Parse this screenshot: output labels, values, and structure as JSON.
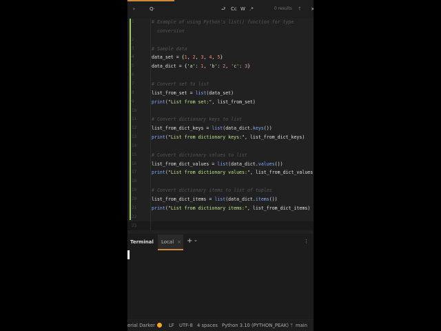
{
  "toolbar": {
    "expand": "›",
    "search_icon": "Q·",
    "replace_icon": "⮐",
    "match_case": "Cc",
    "words": "W",
    "regex": ".*",
    "results": "0 results",
    "up": "↑",
    "close": "×"
  },
  "editor": {
    "line_numbers": [
      "1",
      "",
      "2",
      "3",
      "4",
      "5",
      "6",
      "7",
      "8",
      "9",
      "10",
      "11",
      "12",
      "13",
      "14",
      "15",
      "16",
      "17",
      "18",
      "19",
      "20",
      "21",
      "22",
      "23"
    ],
    "lines": [
      [
        [
          "# Example of using Python's list() function for type",
          "cm"
        ]
      ],
      [
        [
          "  conversion",
          "cm"
        ]
      ],
      [],
      [
        [
          "# Sample data",
          "cm"
        ]
      ],
      [
        [
          "data_set = {",
          "pl"
        ],
        [
          "1",
          "nm"
        ],
        [
          ", ",
          "pl"
        ],
        [
          "2",
          "nm"
        ],
        [
          ", ",
          "pl"
        ],
        [
          "3",
          "nm"
        ],
        [
          ", ",
          "pl"
        ],
        [
          "4",
          "nm"
        ],
        [
          ", ",
          "pl"
        ],
        [
          "5",
          "nm"
        ],
        [
          "}",
          "pl"
        ]
      ],
      [
        [
          "data_dict = {",
          "pl"
        ],
        [
          "'a'",
          "st"
        ],
        [
          ": ",
          "pl"
        ],
        [
          "1",
          "nm"
        ],
        [
          ", ",
          "pl"
        ],
        [
          "'b'",
          "st"
        ],
        [
          ": ",
          "pl"
        ],
        [
          "2",
          "nm"
        ],
        [
          ", ",
          "pl"
        ],
        [
          "'c'",
          "st"
        ],
        [
          ": ",
          "pl"
        ],
        [
          "3",
          "nm"
        ],
        [
          "}",
          "pl"
        ]
      ],
      [],
      [
        [
          "# Convert set to list",
          "cm"
        ]
      ],
      [
        [
          "list_from_set = ",
          "pl"
        ],
        [
          "list",
          "kw"
        ],
        [
          "(data_set)",
          "pl"
        ]
      ],
      [
        [
          "print",
          "fn"
        ],
        [
          "(",
          "pl"
        ],
        [
          "\"List from set:\"",
          "st"
        ],
        [
          ", list_from_set)",
          "pl"
        ]
      ],
      [],
      [
        [
          "# Convert dictionary keys to list",
          "cm"
        ]
      ],
      [
        [
          "list_from_dict_keys = ",
          "pl"
        ],
        [
          "list",
          "kw"
        ],
        [
          "(data_dict.",
          "pl"
        ],
        [
          "keys",
          "fn"
        ],
        [
          "())",
          "pl"
        ]
      ],
      [
        [
          "print",
          "fn"
        ],
        [
          "(",
          "pl"
        ],
        [
          "\"List from dictionary keys:\"",
          "st"
        ],
        [
          ", list_from_dict_keys)",
          "pl"
        ]
      ],
      [],
      [
        [
          "# Convert dictionary values to list",
          "cm"
        ]
      ],
      [
        [
          "list_from_dict_values = ",
          "pl"
        ],
        [
          "list",
          "kw"
        ],
        [
          "(data_dict.",
          "pl"
        ],
        [
          "values",
          "fn"
        ],
        [
          "())",
          "pl"
        ]
      ],
      [
        [
          "print",
          "fn"
        ],
        [
          "(",
          "pl"
        ],
        [
          "\"List from dictionary values:\"",
          "st"
        ],
        [
          ", list_from_dict_values)",
          "pl"
        ]
      ],
      [],
      [
        [
          "# Convert dictionary items to list of tuples",
          "cm"
        ]
      ],
      [
        [
          "list_from_dict_items = ",
          "pl"
        ],
        [
          "list",
          "kw"
        ],
        [
          "(data_dict.",
          "pl"
        ],
        [
          "items",
          "fn"
        ],
        [
          "())",
          "pl"
        ]
      ],
      [
        [
          "print",
          "fn"
        ],
        [
          "(",
          "pl"
        ],
        [
          "\"List from dictionary items:\"",
          "st"
        ],
        [
          ", list_from_dict_items)",
          "pl"
        ]
      ],
      [],
      []
    ]
  },
  "terminal": {
    "title": "Terminal",
    "tab": "Local",
    "tab_close": "×",
    "add": "+",
    "dropdown": "⌄",
    "more": "⋮"
  },
  "status": {
    "theme": "erial Darker",
    "line_sep": "LF",
    "encoding": "UTF-8",
    "indent": "4 spaces",
    "interpreter": "Python 3.10 (PYTHON_PEAK)",
    "branch_icon": "ᛘ",
    "branch": "main"
  }
}
